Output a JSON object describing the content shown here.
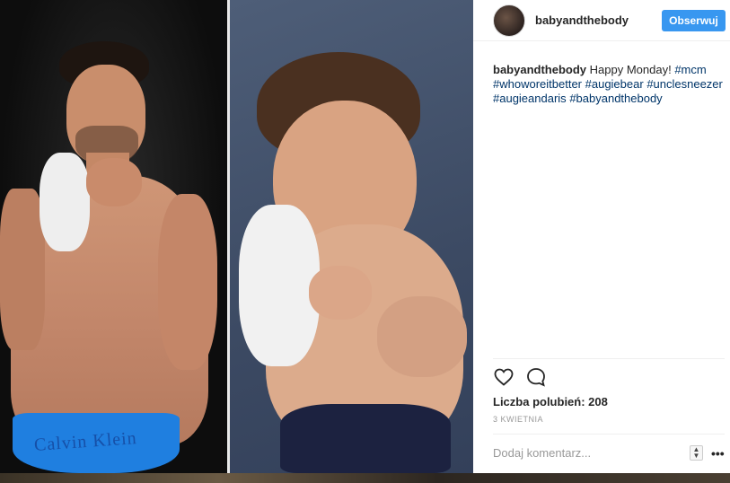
{
  "post": {
    "left_photo_text": "Calvin Klein",
    "colors": {
      "follow_button": "#3897f0",
      "hashtag": "#003569",
      "underwear": "#1f7fe0"
    }
  },
  "header": {
    "username": "babyandthebody",
    "follow_label": "Obserwuj"
  },
  "caption": {
    "author": "babyandthebody",
    "text": "Happy Monday!",
    "hashtags": [
      "#mcm",
      "#whoworeitbetter",
      "#augiebear",
      "#unclesneezer",
      "#augieandaris",
      "#babyandthebody"
    ]
  },
  "actions": {
    "like_icon": "heart-icon",
    "comment_icon": "comment-icon",
    "likes_text": "Liczba polubień: 208",
    "date": "3 KWIETNIA"
  },
  "comment": {
    "placeholder": "Dodaj komentarz...",
    "more_icon": "more-options-icon"
  }
}
